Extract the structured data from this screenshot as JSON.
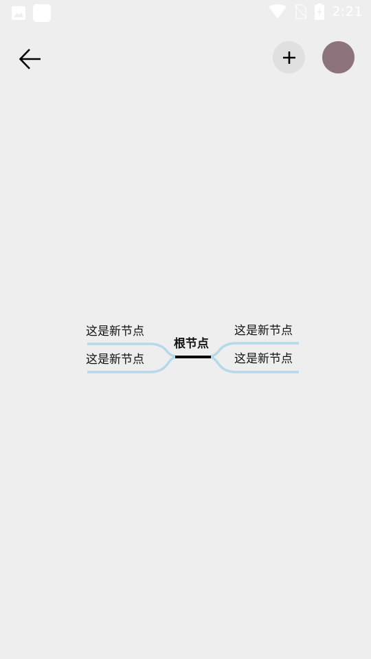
{
  "status_bar": {
    "time": "2:21",
    "left_icons": [
      "image-icon",
      "app-square-icon"
    ],
    "right_icons": [
      "wifi-icon",
      "no-sim-icon",
      "battery-charging-icon"
    ]
  },
  "app_bar": {
    "back_icon": "arrow-left-icon",
    "add_icon": "plus-icon",
    "theme_color": "#8d747c"
  },
  "mindmap": {
    "root": {
      "label": "根节点"
    },
    "left_children": [
      {
        "label": "这是新节点"
      },
      {
        "label": "这是新节点"
      }
    ],
    "right_children": [
      {
        "label": "这是新节点"
      },
      {
        "label": "这是新节点"
      }
    ],
    "branch_color": "#b5d9ea",
    "root_underline_color": "#000000"
  }
}
